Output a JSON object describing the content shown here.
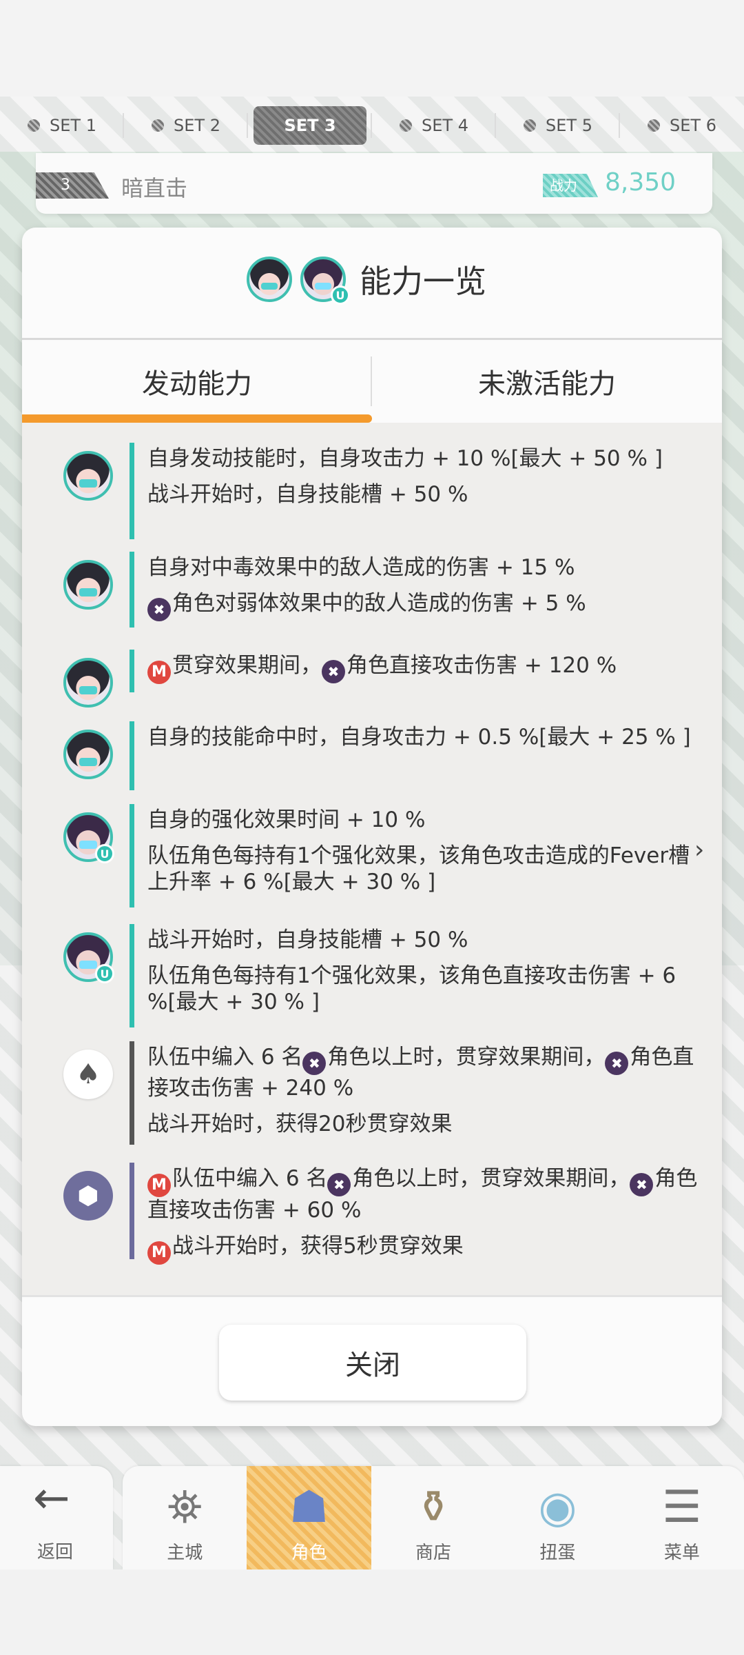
{
  "set_tabs": [
    {
      "label": "SET 1",
      "active": false
    },
    {
      "label": "SET 2",
      "active": false
    },
    {
      "label": "SET 3",
      "active": true
    },
    {
      "label": "SET 4",
      "active": false
    },
    {
      "label": "SET 5",
      "active": false
    },
    {
      "label": "SET 6",
      "active": false
    }
  ],
  "skill_strip": {
    "level": "3",
    "name": "暗直击",
    "power_label": "战力",
    "power_value": "8,350"
  },
  "modal": {
    "title": "能力一览",
    "tabs": [
      {
        "label": "发动能力",
        "active": true
      },
      {
        "label": "未激活能力",
        "active": false
      }
    ],
    "close_label": "关闭"
  },
  "abilities": [
    {
      "icon": "character-avatar-a-icon",
      "bar_color": "#2fbfb0",
      "lines": [
        [
          {
            "t": "自身发动技能时，自身攻击力 + 10 %[最大 + 50 % ]"
          }
        ],
        [
          {
            "t": "战斗开始时，自身技能槽 + 50 %"
          }
        ]
      ]
    },
    {
      "icon": "character-avatar-a-icon",
      "bar_color": "#2fbfb0",
      "lines": [
        [
          {
            "t": "自身对中毒效果中的敌人造成的伤害 + 15 %"
          }
        ],
        [
          {
            "s": "✖"
          },
          {
            "t": "角色对弱体效果中的敌人造成的伤害 + 5 %"
          }
        ]
      ]
    },
    {
      "icon": "character-avatar-a-icon",
      "bar_color": "#2fbfb0",
      "lines": [
        [
          {
            "m": "M"
          },
          {
            "t": "贯穿效果期间，"
          },
          {
            "s": "✖"
          },
          {
            "t": "角色直接攻击伤害 + 120 %"
          }
        ]
      ]
    },
    {
      "icon": "character-avatar-a-icon",
      "bar_color": "#2fbfb0",
      "lines": [
        [
          {
            "t": "自身的技能命中时，自身攻击力 + 0.5 %[最大 + 25 % ]"
          }
        ]
      ]
    },
    {
      "icon": "character-avatar-b-icon",
      "bar_color": "#2fbfb0",
      "lines": [
        [
          {
            "t": "自身的强化效果时间 + 10 %"
          }
        ],
        [
          {
            "t": "队伍角色每持有1个强化效果，该角色攻击造成的Fever槽上升率 + 6 %[最大 + 30 % ]"
          }
        ]
      ]
    },
    {
      "icon": "character-avatar-b-icon",
      "bar_color": "#2fbfb0",
      "lines": [
        [
          {
            "t": "战斗开始时，自身技能槽 + 50 %"
          }
        ],
        [
          {
            "t": "队伍角色每持有1个强化效果，该角色直接攻击伤害 + 6 %[最大 + 30 % ]"
          }
        ]
      ]
    },
    {
      "icon": "weapon-spade-icon",
      "bar_color": "#555555",
      "lines": [
        [
          {
            "t": "队伍中编入 6 名"
          },
          {
            "s": "✖"
          },
          {
            "t": "角色以上时，贯穿效果期间，"
          },
          {
            "s": "✖"
          },
          {
            "t": "角色直接攻击伤害 + 240 %"
          }
        ],
        [
          {
            "t": "战斗开始时，获得20秒贯穿效果"
          }
        ]
      ]
    },
    {
      "icon": "box-emblem-icon",
      "bar_color": "#6b6a9c",
      "lines": [
        [
          {
            "m": "M"
          },
          {
            "t": "队伍中编入 6 名"
          },
          {
            "s": "✖"
          },
          {
            "t": "角色以上时，贯穿效果期间，"
          },
          {
            "s": "✖"
          },
          {
            "t": "角色直接攻击伤害 + 60 %"
          }
        ],
        [
          {
            "m": "M"
          },
          {
            "t": "战斗开始时，获得5秒贯穿效果"
          }
        ]
      ]
    }
  ],
  "bottom_nav": {
    "back": {
      "label": "返回",
      "icon": "back-arrow-icon"
    },
    "items": [
      {
        "label": "主城",
        "icon": "castle-icon",
        "active": false
      },
      {
        "label": "角色",
        "icon": "character-icon",
        "active": true
      },
      {
        "label": "商店",
        "icon": "shop-icon",
        "active": false
      },
      {
        "label": "扭蛋",
        "icon": "gacha-icon",
        "active": false
      },
      {
        "label": "菜单",
        "icon": "menu-icon",
        "active": false
      }
    ]
  }
}
